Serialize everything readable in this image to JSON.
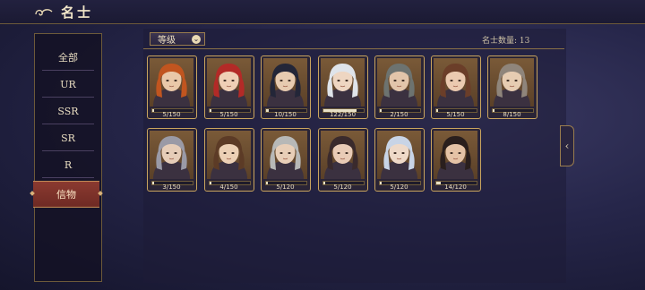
{
  "header": {
    "title": "名士"
  },
  "sidebar": {
    "items": [
      {
        "label": "全部"
      },
      {
        "label": "UR"
      },
      {
        "label": "SSR"
      },
      {
        "label": "SR"
      },
      {
        "label": "R"
      },
      {
        "label": "信物"
      }
    ],
    "selected": "信物"
  },
  "filter": {
    "label": "等级",
    "icon": "chevron-down-icon"
  },
  "count": {
    "text": "名士数量: 13"
  },
  "cards": [
    {
      "progress": "5/150",
      "value": 5,
      "max": 150,
      "hair": "#c1551f",
      "skin": "#e9c8a8"
    },
    {
      "progress": "5/150",
      "value": 5,
      "max": 150,
      "hair": "#b32a27",
      "skin": "#efcfb5"
    },
    {
      "progress": "10/150",
      "value": 10,
      "max": 150,
      "hair": "#232638",
      "skin": "#e7cbb0"
    },
    {
      "progress": "122/150",
      "value": 122,
      "max": 150,
      "hair": "#dfe4ea",
      "skin": "#eed6c2"
    },
    {
      "progress": "2/150",
      "value": 2,
      "max": 150,
      "hair": "#6d7370",
      "skin": "#e2c5aa"
    },
    {
      "progress": "5/150",
      "value": 5,
      "max": 150,
      "hair": "#6b3e29",
      "skin": "#ebcab0"
    },
    {
      "progress": "8/150",
      "value": 8,
      "max": 150,
      "hair": "#8f857b",
      "skin": "#e6ccb2"
    },
    {
      "progress": "3/150",
      "value": 3,
      "max": 150,
      "hair": "#9a9aa6",
      "skin": "#e6cdb8"
    },
    {
      "progress": "4/150",
      "value": 4,
      "max": 150,
      "hair": "#5c3b26",
      "skin": "#ecd0b5"
    },
    {
      "progress": "5/120",
      "value": 5,
      "max": 120,
      "hair": "#b7b8b7",
      "skin": "#e8ceb7"
    },
    {
      "progress": "5/120",
      "value": 5,
      "max": 120,
      "hair": "#3a2a2c",
      "skin": "#e9cbb6"
    },
    {
      "progress": "5/120",
      "value": 5,
      "max": 120,
      "hair": "#c8d4e6",
      "skin": "#eed9c8"
    },
    {
      "progress": "14/120",
      "value": 14,
      "max": 120,
      "hair": "#2a1f1d",
      "skin": "#e5c3a6"
    }
  ],
  "colors": {
    "accent_gold": "#c9a45e",
    "active_red": "#7a2f28",
    "panel": "#1b1a33"
  }
}
